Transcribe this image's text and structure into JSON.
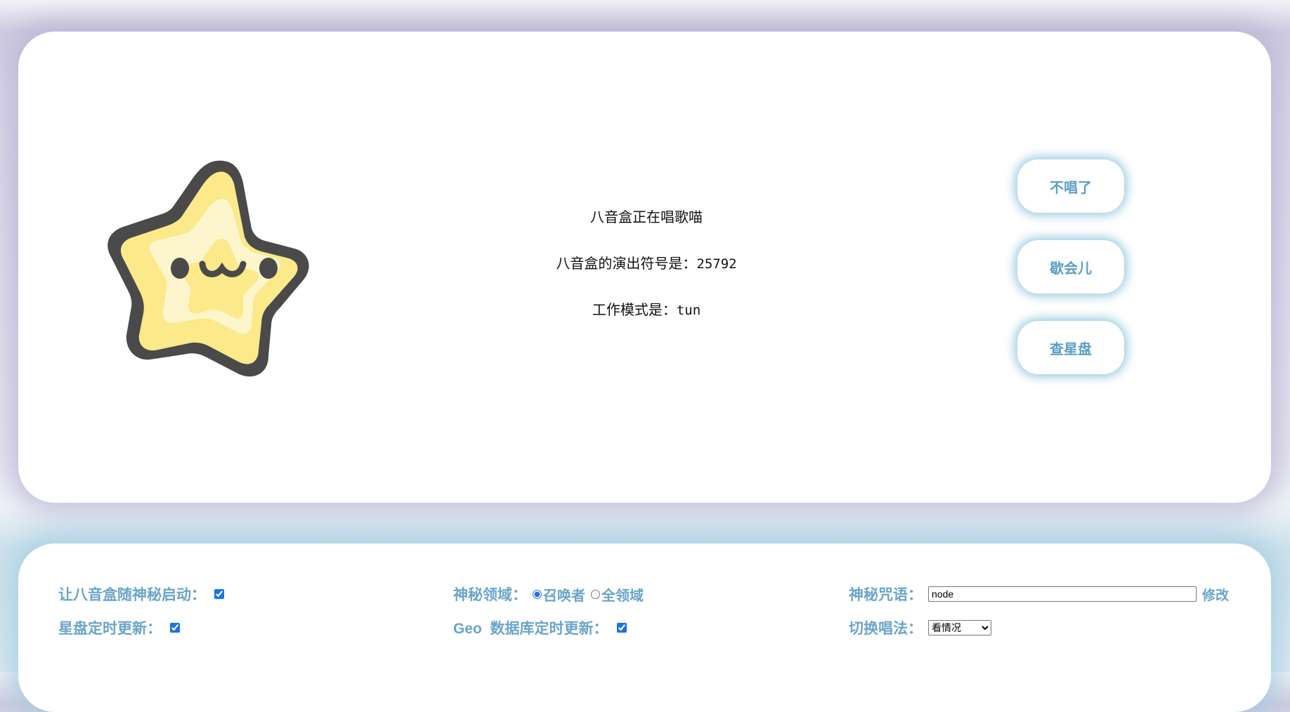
{
  "status": {
    "line1": "八音盒正在唱歌喵",
    "line2_label": "八音盒的演出符号是：",
    "line2_value": "25792",
    "line3_label": "工作模式是：",
    "line3_value": "tun"
  },
  "buttons": {
    "stop": "不唱了",
    "rest": "歇会儿",
    "check": "查星盘"
  },
  "settings": {
    "autostart_label": "让八音盒随神秘启动：",
    "autostart_checked": true,
    "starchart_update_label": "星盘定时更新：",
    "starchart_update_checked": true,
    "domain_label": "神秘领域：",
    "domain_options": [
      "召唤者",
      "全领域"
    ],
    "domain_selected": "召唤者",
    "geo_label": "Geo  数据库定时更新：",
    "geo_checked": true,
    "spell_label": "神秘咒语：",
    "spell_value": "node",
    "spell_edit": "修改",
    "mode_label": "切换唱法：",
    "mode_selected": "看情况"
  },
  "colors": {
    "accent": "#6aa5c9",
    "star_fill": "#fbe98a",
    "star_inner": "#fdf6cc",
    "star_outline": "#4a4a4a"
  }
}
